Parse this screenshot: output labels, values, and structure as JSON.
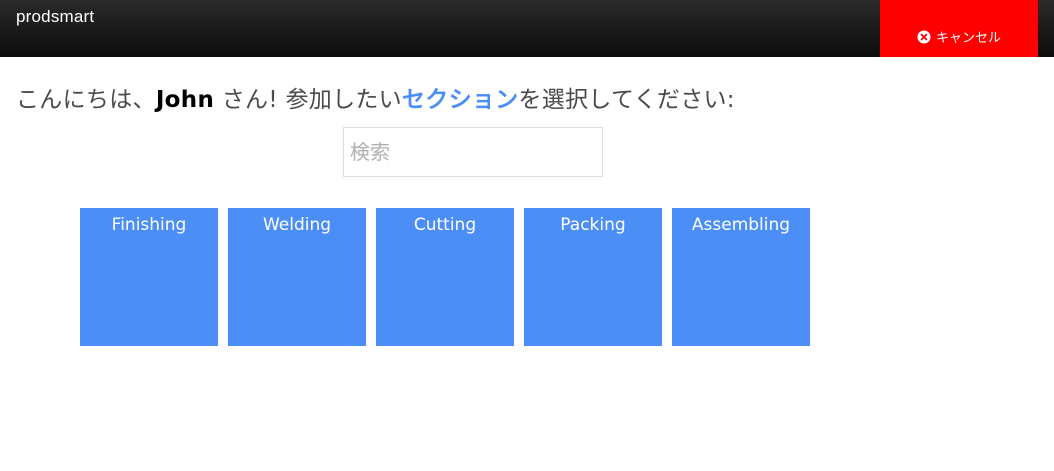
{
  "header": {
    "logo_text": "prodsmart",
    "cancel_label": "キャンセル",
    "cancel_icon": "close-circle-icon",
    "cancel_color": "#fe0000"
  },
  "greeting": {
    "prefix": "こんにちは、",
    "username": "John",
    "middle": " さん! 参加したい",
    "highlight": "セクション",
    "suffix": "を選択してください:"
  },
  "search": {
    "placeholder": "検索",
    "value": ""
  },
  "sections": [
    {
      "label": "Finishing"
    },
    {
      "label": "Welding"
    },
    {
      "label": "Cutting"
    },
    {
      "label": "Packing"
    },
    {
      "label": "Assembling"
    }
  ],
  "colors": {
    "accent": "#4a8ef6",
    "header_bg": "#1a1a1a"
  }
}
